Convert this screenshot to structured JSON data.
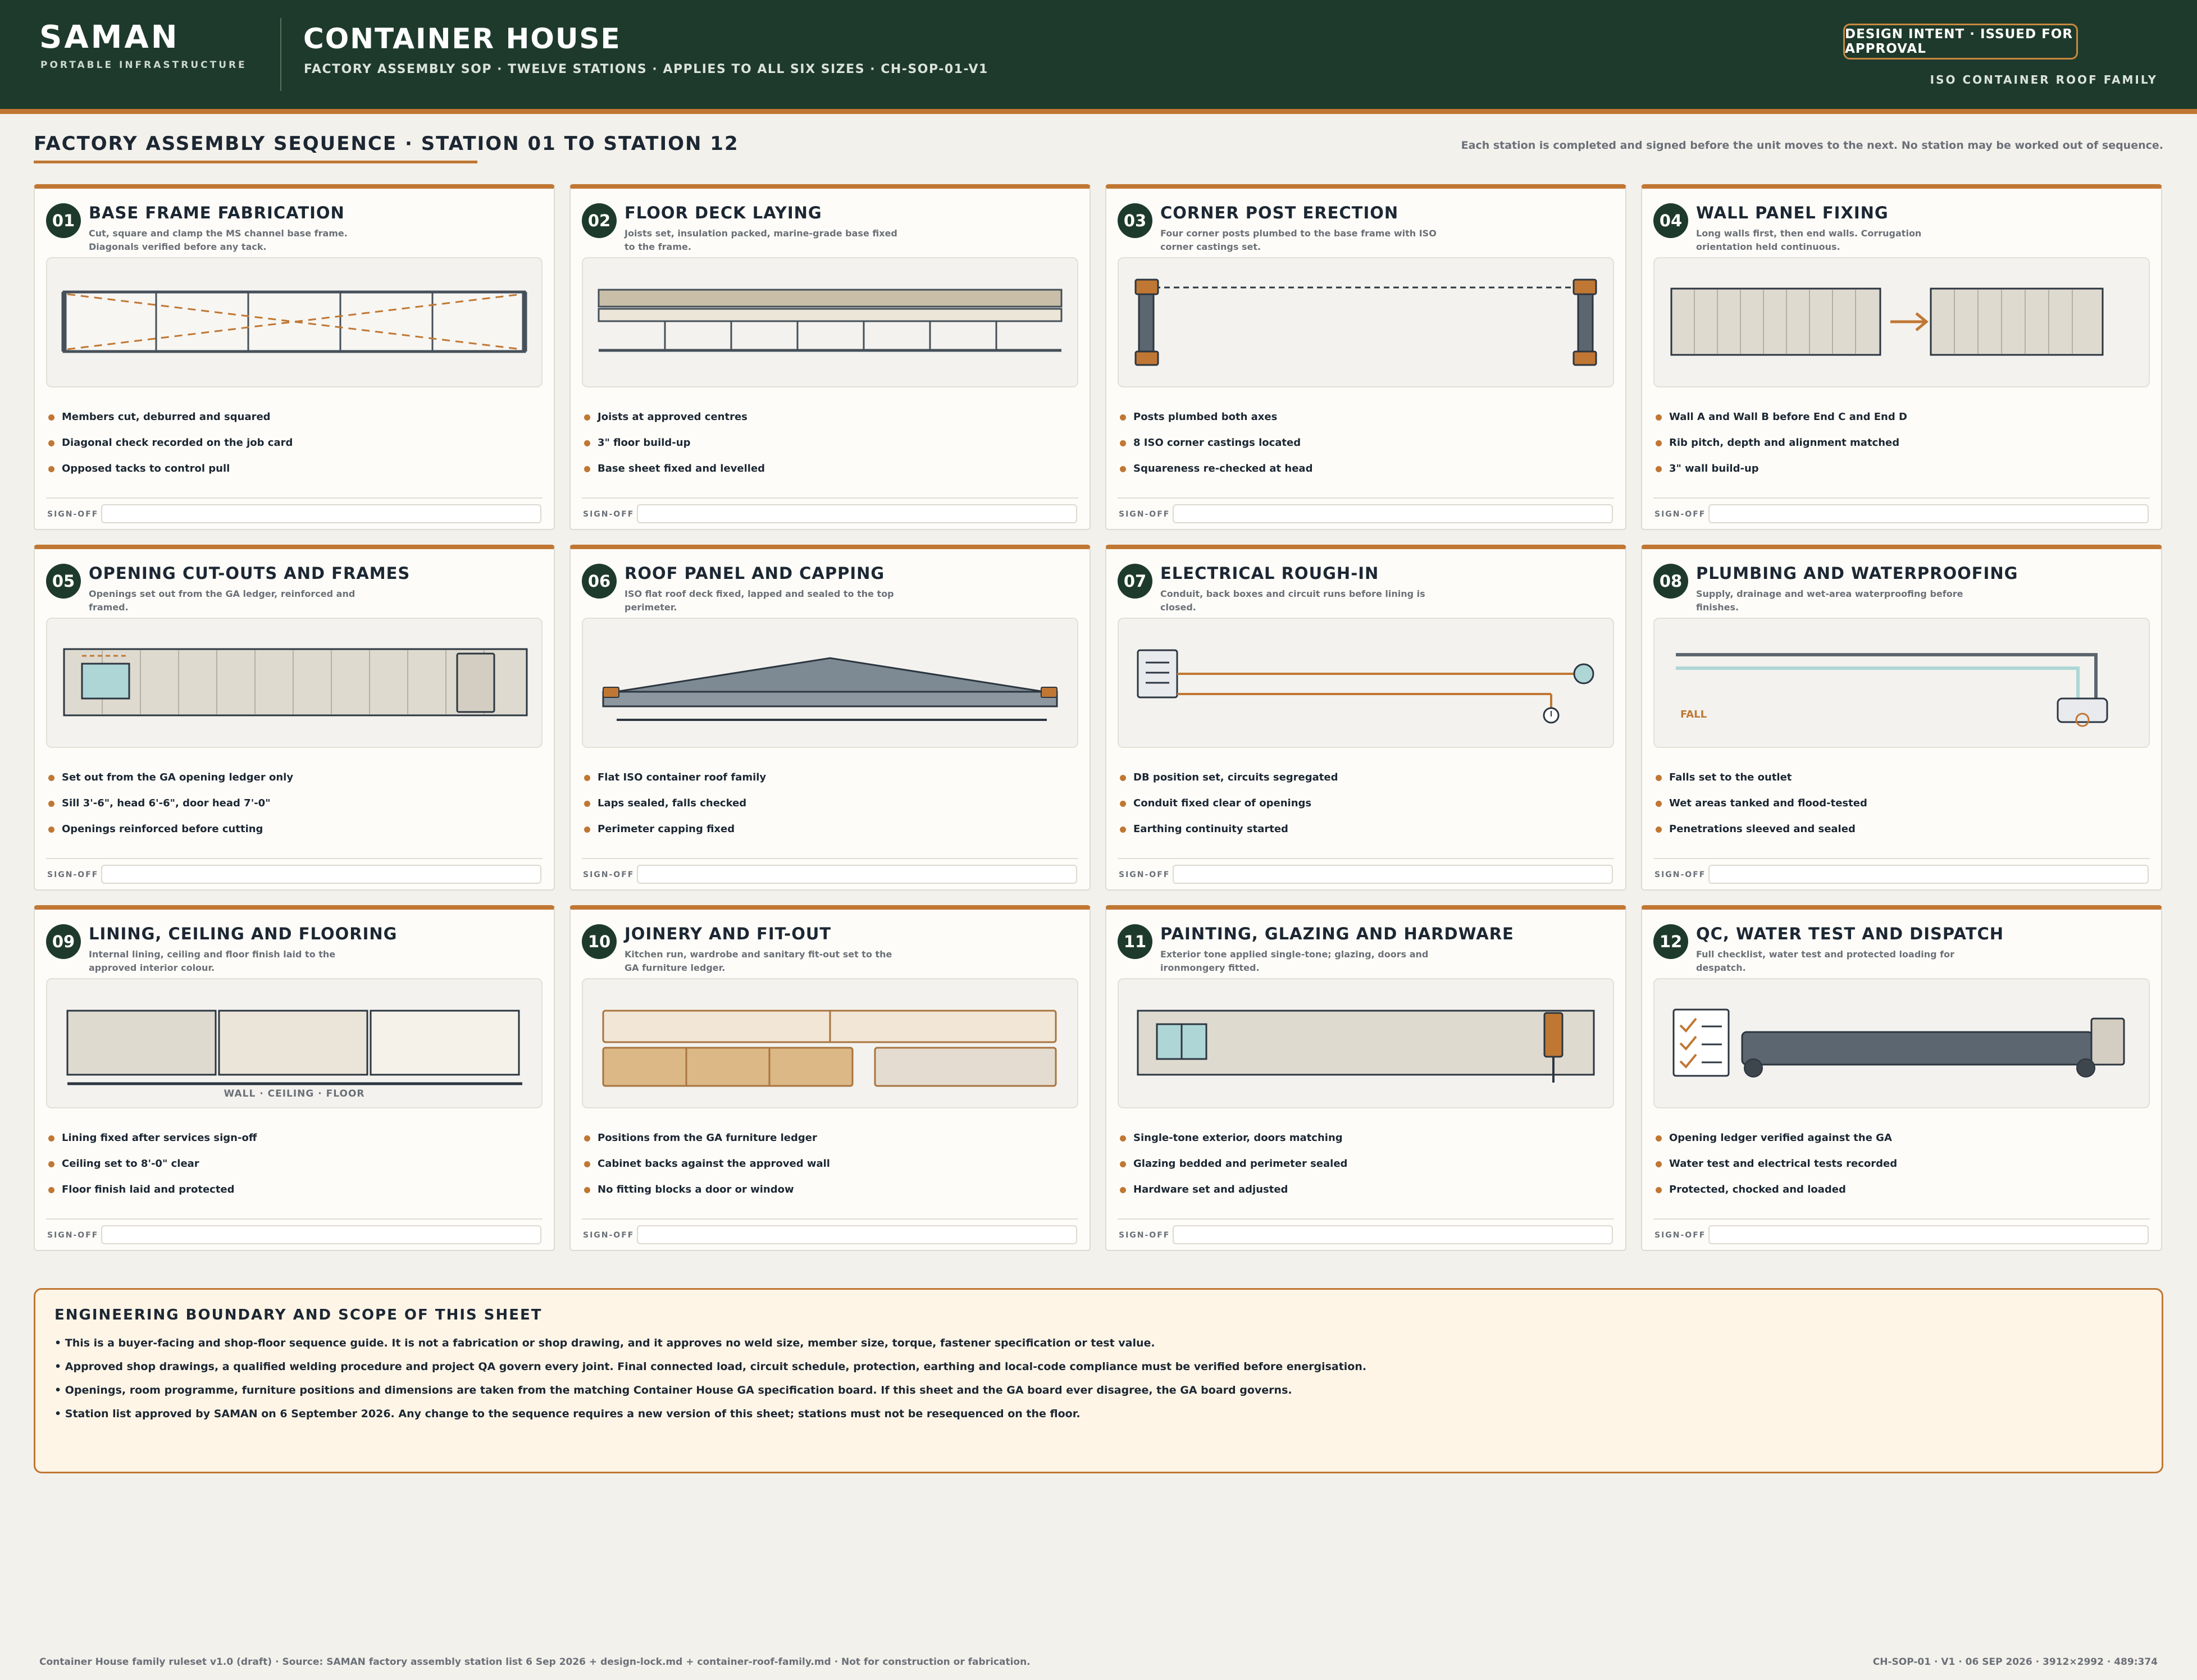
{
  "header": {
    "brand": "SAMAN",
    "brand_tagline": "PORTABLE INFRASTRUCTURE",
    "title": "CONTAINER HOUSE",
    "subtitle": "FACTORY ASSEMBLY SOP · TWELVE STATIONS · APPLIES TO ALL SIX SIZES · CH-SOP-01-V1",
    "status_badge": "DESIGN INTENT · ISSUED FOR APPROVAL",
    "roof_family": "ISO CONTAINER ROOF FAMILY"
  },
  "section": {
    "title": "FACTORY ASSEMBLY SEQUENCE · STATION 01 TO STATION 12",
    "note": "Each station is completed and signed before the unit moves to the next. No station may be worked out of sequence."
  },
  "signoff_label": "SIGN-OFF",
  "stations": [
    {
      "num": "01",
      "title": "BASE FRAME FABRICATION",
      "desc": "Cut, square and clamp the MS channel base frame. Diagonals verified before any tack.",
      "icon": "base-frame-diagram",
      "bullets": [
        "Members cut, deburred and squared",
        "Diagonal check recorded on the job card",
        "Opposed tacks to control pull"
      ]
    },
    {
      "num": "02",
      "title": "FLOOR DECK LAYING",
      "desc": "Joists set, insulation packed, marine-grade base fixed to the frame.",
      "icon": "floor-deck-diagram",
      "bullets": [
        "Joists at approved centres",
        "3\" floor build-up",
        "Base sheet fixed and levelled"
      ]
    },
    {
      "num": "03",
      "title": "CORNER POST ERECTION",
      "desc": "Four corner posts plumbed to the base frame with ISO corner castings set.",
      "icon": "corner-post-diagram",
      "bullets": [
        "Posts plumbed both axes",
        "8 ISO corner castings located",
        "Squareness re-checked at head"
      ]
    },
    {
      "num": "04",
      "title": "WALL PANEL FIXING",
      "desc": "Long walls first, then end walls. Corrugation orientation held continuous.",
      "icon": "wall-panel-diagram",
      "bullets": [
        "Wall A and Wall B before End C and End D",
        "Rib pitch, depth and alignment matched",
        "3\" wall build-up"
      ]
    },
    {
      "num": "05",
      "title": "OPENING CUT-OUTS AND FRAMES",
      "desc": "Openings set out from the GA ledger, reinforced and framed.",
      "icon": "opening-cutout-diagram",
      "bullets": [
        "Set out from the GA opening ledger only",
        "Sill 3'-6\", head 6'-6\", door head 7'-0\"",
        "Openings reinforced before cutting"
      ]
    },
    {
      "num": "06",
      "title": "ROOF PANEL AND CAPPING",
      "desc": "ISO flat roof deck fixed, lapped and sealed to the top perimeter.",
      "icon": "roof-panel-diagram",
      "bullets": [
        "Flat ISO container roof family",
        "Laps sealed, falls checked",
        "Perimeter capping fixed"
      ]
    },
    {
      "num": "07",
      "title": "ELECTRICAL ROUGH-IN",
      "desc": "Conduit, back boxes and circuit runs before lining is closed.",
      "icon": "electrical-diagram",
      "bullets": [
        "DB position set, circuits segregated",
        "Conduit fixed clear of openings",
        "Earthing continuity started"
      ]
    },
    {
      "num": "08",
      "title": "PLUMBING AND WATERPROOFING",
      "desc": "Supply, drainage and wet-area waterproofing before finishes.",
      "icon": "plumbing-diagram",
      "fall_label": "FALL",
      "bullets": [
        "Falls set to the outlet",
        "Wet areas tanked and flood-tested",
        "Penetrations sleeved and sealed"
      ]
    },
    {
      "num": "09",
      "title": "LINING, CEILING AND FLOORING",
      "desc": "Internal lining, ceiling and floor finish laid to the approved interior colour.",
      "icon": "lining-diagram",
      "diagram_label": "WALL · CEILING · FLOOR",
      "bullets": [
        "Lining fixed after services sign-off",
        "Ceiling set to 8'-0\" clear",
        "Floor finish laid and protected"
      ]
    },
    {
      "num": "10",
      "title": "JOINERY AND FIT-OUT",
      "desc": "Kitchen run, wardrobe and sanitary fit-out set to the GA furniture ledger.",
      "icon": "joinery-diagram",
      "bullets": [
        "Positions from the GA furniture ledger",
        "Cabinet backs against the approved wall",
        "No fitting blocks a door or window"
      ]
    },
    {
      "num": "11",
      "title": "PAINTING, GLAZING AND HARDWARE",
      "desc": "Exterior tone applied single-tone; glazing, doors and ironmongery fitted.",
      "icon": "painting-diagram",
      "bullets": [
        "Single-tone exterior, doors matching",
        "Glazing bedded and perimeter sealed",
        "Hardware set and adjusted"
      ]
    },
    {
      "num": "12",
      "title": "QC, WATER TEST AND DISPATCH",
      "desc": "Full checklist, water test and protected loading for despatch.",
      "icon": "dispatch-diagram",
      "bullets": [
        "Opening ledger verified against the GA",
        "Water test and electrical tests recorded",
        "Protected, chocked and loaded"
      ]
    }
  ],
  "scope": {
    "title": "ENGINEERING BOUNDARY AND SCOPE OF THIS SHEET",
    "items": [
      "• This is a buyer-facing and shop-floor sequence guide. It is not a fabrication or shop drawing, and it approves no weld size, member size, torque, fastener specification or test value.",
      "• Approved shop drawings, a qualified welding procedure and project QA govern every joint. Final connected load, circuit schedule, protection, earthing and local-code compliance must be verified before energisation.",
      "• Openings, room programme, furniture positions and dimensions are taken from the matching Container House GA specification board. If this sheet and the GA board ever disagree, the GA board governs.",
      "• Station list approved by SAMAN on 6 September 2026. Any change to the sequence requires a new version of this sheet; stations must not be resequenced on the floor."
    ]
  },
  "footer": {
    "left": "Container House family ruleset v1.0 (draft) · Source: SAMAN factory assembly station list 6 Sep 2026 + design-lock.md + container-roof-family.md · Not for construction or fabrication.",
    "right": "CH-SOP-01 · V1 · 06 SEP 2026 · 3912×2992 · 489:374"
  },
  "colors": {
    "brand_green": "#1e3a2c",
    "accent_orange": "#c07733",
    "page_bg": "#f3f1ec",
    "card_bg": "#fdfcf8",
    "steel": "#5b6670",
    "aqua": "#a9d3d2"
  }
}
